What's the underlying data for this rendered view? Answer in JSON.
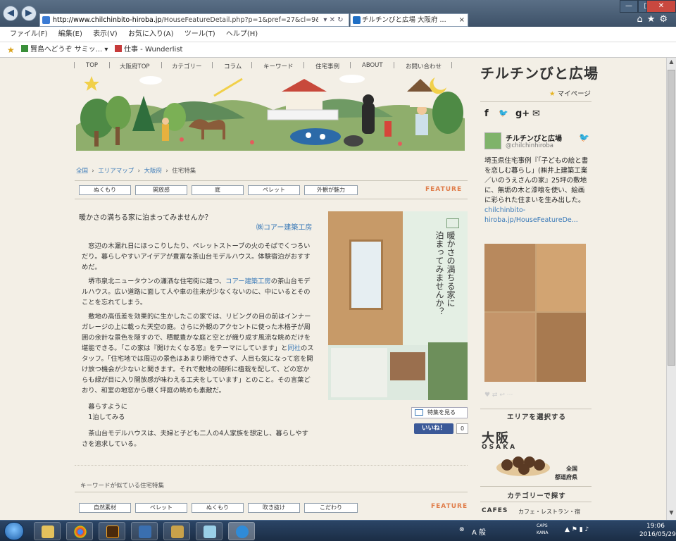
{
  "browser": {
    "address_domain": "http://www.chilchinbito-hiroba.jp",
    "address_path": "/HouseFeatureDetail.php?p=1&pref=27&cl=9&cic=27",
    "address_controls": "▾ ✕ ↻",
    "tab_title": "チルチンびと広場 大阪府 ...",
    "tab_close": "×",
    "back_arrow": "◀",
    "forward_arrow": "▶",
    "window_minimize": "—",
    "window_maximize": "□",
    "window_close": "✕",
    "toolbar_icons": "⌂★⚙"
  },
  "menu": [
    "ファイル(F)",
    "編集(E)",
    "表示(V)",
    "お気に入り(A)",
    "ツール(T)",
    "ヘルプ(H)"
  ],
  "favorites": {
    "item1": "賢島へどうぞ サミッ...",
    "item1_arrow": "▾",
    "item2": "仕事 - Wunderlist"
  },
  "site": {
    "global_nav": [
      "TOP",
      "大阪府TOP",
      "カテゴリー",
      "コラム",
      "キーワード",
      "住宅事例",
      "ABOUT",
      "お問い合わせ"
    ],
    "nav_separator": "|",
    "breadcrumb": [
      "全国",
      "エリアマップ",
      "大阪府",
      "住宅特集"
    ],
    "breadcrumb_separator": "›",
    "tags": [
      "ぬくもり",
      "開放感",
      "庭",
      "ペレット",
      "外観が魅力"
    ],
    "feature_label": "FEATURE",
    "article_title": "暖かさの満ちる家に泊まってみませんか？",
    "builder_link": "㈱コアー建築工房",
    "para1": "窓辺の木漏れ日にほっこりしたり、ペレットストーブの火のそばでくつろいだり。暮らしやすいアイデアが豊富な茶山台モデルハウス。体験宿泊がおすすめだ。",
    "para2_before": "堺市泉北ニュータウンの瀟洒な住宅街に建つ、",
    "para2_link": "コアー建築工房",
    "para2_after": "の茶山台モデルハウス。広い道路に面して人や車の往来が少なくないのに、中にいるとそのことを忘れてしまう。",
    "para3_a": "敷地の高低差を効果的に生かしたこの家では、リビングの目の前はインナーガレージの上に載った天空の庭。さらに外観のアクセントに使った木格子が周囲の余計な景色を隠すので、積載豊かな庭と空とが織り成す風流な眺めだけを堪能できる。「この家は『開けたくなる窓』をテーマにしています」と",
    "para3_link": "同社",
    "para3_b": "のスタッフ。「住宅地では周辺の景色はあまり期待できず、人目も気になって窓を開け放つ機会が少ないと聞きます。それで敷地の随所に植栽を配して、どの窓からも緑が目に入り開放感が味わえる工夫をしています」とのこと。その言葉どおり、和室の地窓から覗く坪庭の眺めも素敵だ。",
    "para4_line1": "暮らすように",
    "para4_line2": "1泊してみる",
    "para5": "茶山台モデルハウスは、夫婦と子ども二人の4人家族を想定し、暮らしやすさを追求している。",
    "mag_title_1": "暖かさの満ちる家に",
    "mag_title_2": "泊まってみませんか？",
    "view_feature_btn": "特集を見る",
    "fb_like": "いいね！",
    "fb_count": "0",
    "keyword_heading": "キーワードが似ている住宅特集",
    "tags2": [
      "自然素材",
      "ペレット",
      "ぬくもり",
      "吹き抜け",
      "こだわり"
    ],
    "feature_label2": "FEATURE"
  },
  "sidebar": {
    "logo": "チルチンびと広場",
    "mypage": "マイページ",
    "mypage_star": "★",
    "social": [
      "f",
      "🐦",
      "g+",
      "✉"
    ],
    "tweet_bird": "🐦",
    "tweet_name": "チルチンびと広場",
    "tweet_handle": "@chilchinhiroba",
    "tweet_text": "埼玉県住宅事例『「子どもの絵と書を恋しむ暮らし」(㈱井上建築工業／いのうえさんの家』25坪の敷地に、無垢の木と漆喰を使い、絵画に彩られた住まいを生み出した。",
    "tweet_link": "chilchinbito-hiroba.jp/HouseFeatureDe...",
    "tweet_actions": "♥   ⇄   ↩  ···",
    "area_heading": "エリアを選択する",
    "osaka_kanji": "大阪",
    "osaka_en": "OSAKA",
    "zenkoku1": "全国",
    "zenkoku2": "都道府県",
    "category_heading": "カテゴリーで探す",
    "cafes": "CAFES",
    "cafes_sub": "カフェ・レストラン・宿"
  },
  "taskbar": {
    "clock_time": "19:06",
    "clock_date": "2016/05/29",
    "tray_text": "A 般",
    "caps": "CAPS",
    "kana": "KANA"
  },
  "colors": {
    "page_bg": "#f3efe6",
    "feature_orange": "#e07d4a",
    "link_blue": "#3a7ab8",
    "taskbar": "#1b2d45"
  }
}
